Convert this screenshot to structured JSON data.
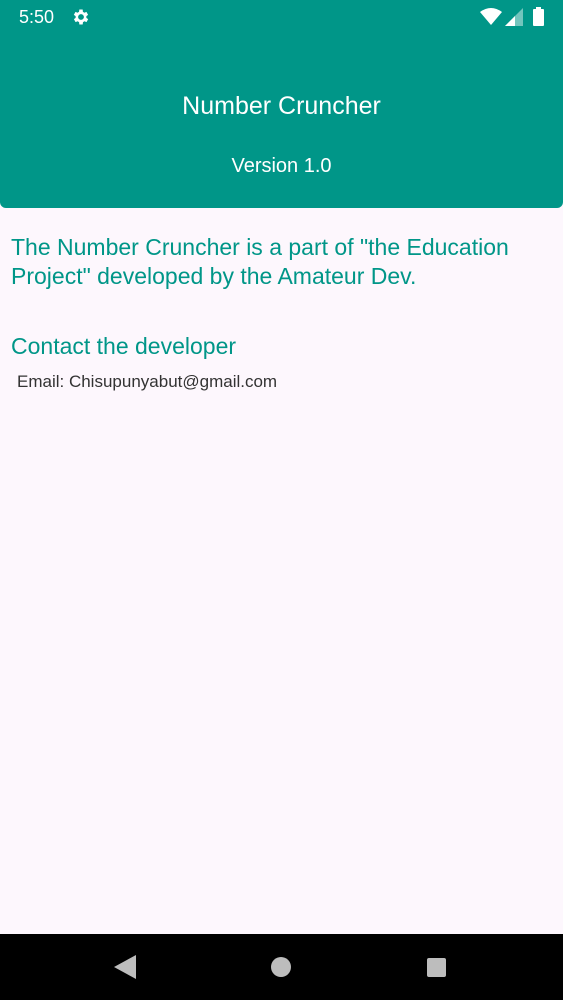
{
  "status_bar": {
    "time": "5:50",
    "icons": [
      "gear-icon",
      "wifi-icon",
      "cell-signal-icon",
      "battery-icon"
    ]
  },
  "header": {
    "title": "Number Cruncher",
    "version": "Version 1.0",
    "color": "#009688"
  },
  "content": {
    "about": "The Number Cruncher is a part of \"the Education Project\" developed by the Amateur Dev.",
    "contact_heading": "Contact the developer",
    "email": "Email: Chisupunyabut@gmail.com"
  },
  "nav_bar": {
    "buttons": [
      "back-icon",
      "home-icon",
      "recents-icon"
    ]
  }
}
